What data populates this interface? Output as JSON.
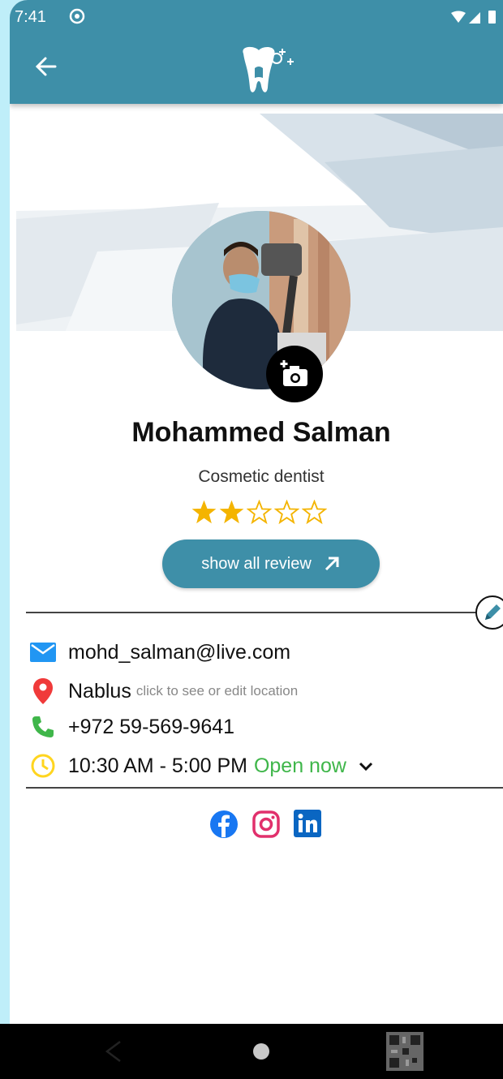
{
  "status_bar": {
    "time": "7:41"
  },
  "profile": {
    "name": "Mohammed Salman",
    "specialty": "Cosmetic dentist",
    "rating": 2,
    "rating_max": 5,
    "review_button": "show all review"
  },
  "contact": {
    "email": "mohd_salman@live.com",
    "location": "Nablus",
    "location_hint": "click to see or edit location",
    "phone": "+972 59-569-9641",
    "hours": "10:30 AM - 5:00 PM",
    "open_status": "Open now"
  },
  "icons": {
    "email": "email-icon",
    "location": "location-pin-icon",
    "phone": "phone-icon",
    "clock": "clock-icon",
    "facebook": "facebook-icon",
    "instagram": "instagram-icon",
    "linkedin": "linkedin-icon"
  },
  "colors": {
    "primary": "#3e8fa8",
    "star": "#f4b400",
    "open": "#3fb64a",
    "page_bg": "#bfeef9"
  }
}
